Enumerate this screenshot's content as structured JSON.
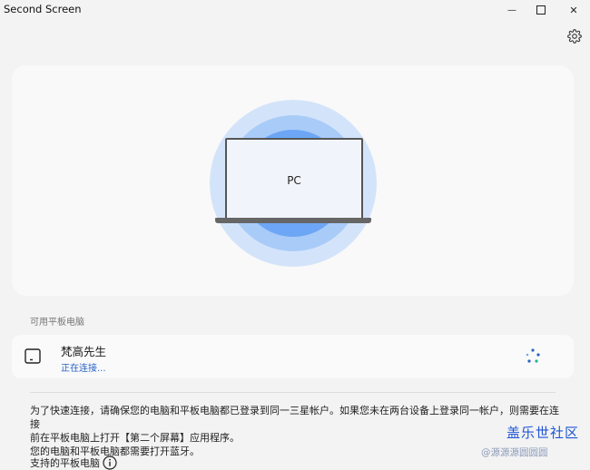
{
  "window": {
    "title": "Second Screen",
    "minimize_glyph": "—",
    "close_glyph": "✕"
  },
  "hero": {
    "device_label": "PC",
    "colors": [
      "#d3e4fa",
      "#a9cbf8",
      "#6ca6f5",
      "#3d8cf2"
    ]
  },
  "available": {
    "section_label": "可用平板电脑",
    "devices": [
      {
        "name": "梵高先生",
        "status": "正在连接...",
        "icon": "tablet-icon"
      }
    ]
  },
  "info": {
    "lines": [
      "为了快速连接，请确保您的电脑和平板电脑都已登录到同一三星帐户。如果您未在两台设备上登录同一帐户，则需要在连接",
      "前在平板电脑上打开【第二个屏幕】应用程序。",
      "您的电脑和平板电脑都需要打开蓝牙。"
    ]
  },
  "supported": {
    "label": "支持的平板电脑"
  },
  "watermark": {
    "main": "盖乐世社区",
    "sub": "@源源源圆圆圆"
  },
  "accent": "#2a63c6"
}
